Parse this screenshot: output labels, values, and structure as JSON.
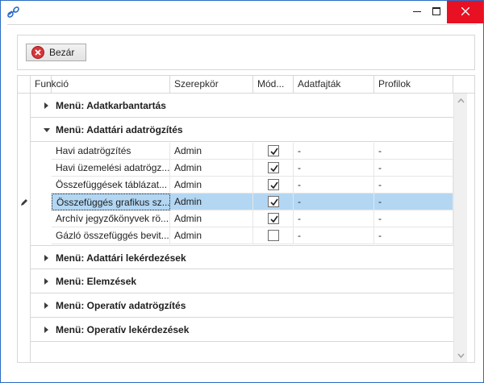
{
  "window": {
    "title": "",
    "icon": "link-icon",
    "controls": [
      "minimize-icon",
      "maximize-icon",
      "close-icon"
    ],
    "accent": "#2b6cc4",
    "close_color": "#e81123"
  },
  "toolbar": {
    "close_label": "Bezár",
    "close_icon": "cancel-icon"
  },
  "grid": {
    "columns": [
      "Funkció",
      "Szerepkör",
      "Mód...",
      "Adatfajták",
      "Profilok"
    ],
    "groups": [
      {
        "label": "Menü: Adatkarbantartás",
        "expanded": false
      },
      {
        "label": "Menü: Adattári adatrögzítés",
        "expanded": true,
        "rows": [
          {
            "funkcio": "Havi adatrögzítés",
            "szerepkor": "Admin",
            "checked": true,
            "adatfajtak": "-",
            "profilok": "-"
          },
          {
            "funkcio": "Havi üzemelési adatrögz...",
            "szerepkor": "Admin",
            "checked": true,
            "adatfajtak": "-",
            "profilok": "-"
          },
          {
            "funkcio": "Összefüggések táblázat...",
            "szerepkor": "Admin",
            "checked": true,
            "adatfajtak": "-",
            "profilok": "-"
          },
          {
            "funkcio": "Összefüggés grafikus sz...",
            "szerepkor": "Admin",
            "checked": true,
            "adatfajtak": "-",
            "profilok": "-",
            "selected": true
          },
          {
            "funkcio": "Archív jegyzőkönyvek rö...",
            "szerepkor": "Admin",
            "checked": true,
            "adatfajtak": "-",
            "profilok": "-"
          },
          {
            "funkcio": "Gázló összefüggés bevit...",
            "szerepkor": "Admin",
            "checked": false,
            "adatfajtak": "-",
            "profilok": "-"
          }
        ]
      },
      {
        "label": "Menü: Adattári lekérdezések",
        "expanded": false
      },
      {
        "label": "Menü: Elemzések",
        "expanded": false
      },
      {
        "label": "Menü: Operatív adatrögzítés",
        "expanded": false
      },
      {
        "label": "Menü: Operatív lekérdezések",
        "expanded": false
      }
    ],
    "selected_color": "#b3d7f3",
    "edit_indicator_icon": "pencil-icon"
  }
}
